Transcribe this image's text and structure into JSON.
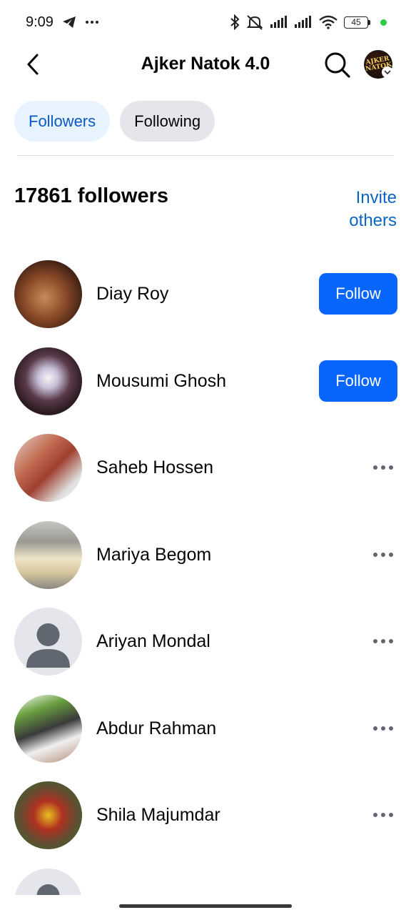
{
  "status_bar": {
    "time": "9:09",
    "battery": "45",
    "icons": [
      "telegram-icon",
      "more-icon",
      "bluetooth-icon",
      "mute-icon",
      "signal-icon",
      "signal-icon",
      "wifi-icon",
      "battery-icon"
    ]
  },
  "header": {
    "title": "Ajker Natok 4.0",
    "avatar_logo_text": "AJKER NATOK"
  },
  "tabs": [
    {
      "label": "Followers",
      "active": true
    },
    {
      "label": "Following",
      "active": false
    }
  ],
  "summary": {
    "count_text": "17861 followers",
    "invite_text": "Invite others"
  },
  "followers": [
    {
      "name": "Diay Roy",
      "action": "Follow"
    },
    {
      "name": "Mousumi Ghosh",
      "action": "Follow"
    },
    {
      "name": "Saheb Hossen",
      "action": "more"
    },
    {
      "name": "Mariya Begom",
      "action": "more"
    },
    {
      "name": "Ariyan Mondal",
      "action": "more"
    },
    {
      "name": "Abdur Rahman",
      "action": "more"
    },
    {
      "name": "Shila Majumdar",
      "action": "more"
    }
  ],
  "colors": {
    "accent": "#0866ff",
    "tab_active_bg": "#e7f3ff",
    "tab_active_text": "#0a58ca",
    "tab_inactive_bg": "#e4e6eb",
    "link": "#0a66c2"
  }
}
